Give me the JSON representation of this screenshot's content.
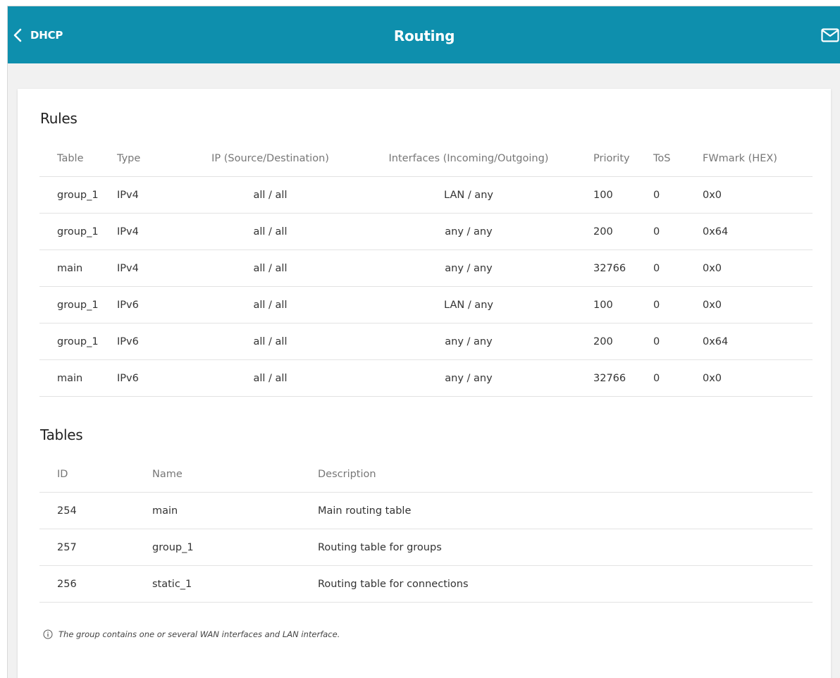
{
  "header": {
    "back_label": "DHCP",
    "title": "Routing",
    "brand_color": "#0e8fad"
  },
  "rules": {
    "title": "Rules",
    "columns": [
      "Table",
      "Type",
      "IP (Source/Destination)",
      "Interfaces (Incoming/Outgoing)",
      "Priority",
      "ToS",
      "FWmark (HEX)"
    ],
    "rows": [
      [
        "group_1",
        "IPv4",
        "all / all",
        "LAN / any",
        "100",
        "0",
        "0x0"
      ],
      [
        "group_1",
        "IPv4",
        "all / all",
        "any / any",
        "200",
        "0",
        "0x64"
      ],
      [
        "main",
        "IPv4",
        "all / all",
        "any / any",
        "32766",
        "0",
        "0x0"
      ],
      [
        "group_1",
        "IPv6",
        "all / all",
        "LAN / any",
        "100",
        "0",
        "0x0"
      ],
      [
        "group_1",
        "IPv6",
        "all / all",
        "any / any",
        "200",
        "0",
        "0x64"
      ],
      [
        "main",
        "IPv6",
        "all / all",
        "any / any",
        "32766",
        "0",
        "0x0"
      ]
    ]
  },
  "tables": {
    "title": "Tables",
    "columns": [
      "ID",
      "Name",
      "Description"
    ],
    "rows": [
      [
        "254",
        "main",
        "Main routing table"
      ],
      [
        "257",
        "group_1",
        "Routing table for groups"
      ],
      [
        "256",
        "static_1",
        "Routing table for connections"
      ]
    ]
  },
  "note": {
    "text": "The group contains one or several WAN interfaces and LAN interface.",
    "icon": "info-icon"
  }
}
